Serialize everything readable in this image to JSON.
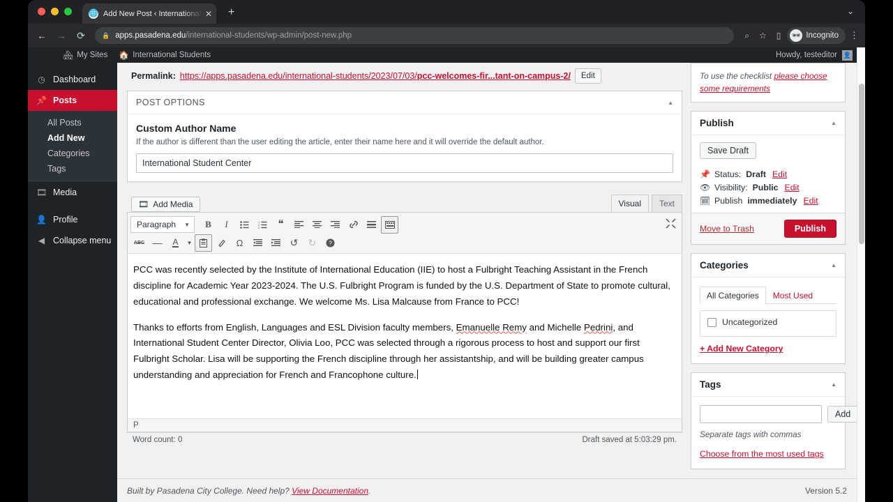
{
  "browser": {
    "tab": {
      "title": "Add New Post ‹ International S",
      "favicon": "globe-icon",
      "close": "✕"
    },
    "newtab_label": "+",
    "window_chevron": "⌄",
    "nav": {
      "back": "←",
      "forward": "→",
      "reload": "⟳"
    },
    "address": {
      "lock": "🔒",
      "domain": "apps.pasadena.edu",
      "path": "/international-students/wp-admin/post-new.php"
    },
    "actions": {
      "search": "⌕",
      "bookmark": "☆",
      "sidepanel": "▯",
      "kebab": "⋮"
    },
    "profile": {
      "label": "Incognito",
      "icon": "incognito-icon"
    }
  },
  "adminbar": {
    "my_sites": "My Sites",
    "site_name": "International Students",
    "howdy": "Howdy, testeditor"
  },
  "sidebar": {
    "items": [
      {
        "label": "Dashboard",
        "icon": "dashboard-icon"
      },
      {
        "label": "Posts",
        "icon": "pin-icon"
      },
      {
        "label": "Media",
        "icon": "media-icon"
      },
      {
        "label": "Profile",
        "icon": "user-icon"
      },
      {
        "label": "Collapse menu",
        "icon": "collapse-icon"
      }
    ],
    "posts_submenu": [
      {
        "label": "All Posts"
      },
      {
        "label": "Add New"
      },
      {
        "label": "Categories"
      },
      {
        "label": "Tags"
      }
    ]
  },
  "permalink": {
    "label": "Permalink:",
    "base": "https://apps.pasadena.edu/international-students/2023/07/03/",
    "slug": "pcc-welcomes-fir...tant-on-campus-2/",
    "edit_button": "Edit"
  },
  "post_options": {
    "panel_title": "POST OPTIONS",
    "field_title": "Custom Author Name",
    "field_description": "If the author is different than the user editing the article, enter their name here and it will override the default author.",
    "field_value": "International Student Center",
    "field_placeholder": ""
  },
  "editor": {
    "add_media": "Add Media",
    "tab_visual": "Visual",
    "tab_text": "Text",
    "format_select": "Paragraph",
    "toolbar_row1": [
      {
        "name": "bold-icon",
        "glyph": "B"
      },
      {
        "name": "italic-icon",
        "glyph": "I"
      },
      {
        "name": "bulleted-list-icon",
        "glyph": "☰"
      },
      {
        "name": "numbered-list-icon",
        "glyph": "☰"
      },
      {
        "name": "blockquote-icon",
        "glyph": "❝"
      },
      {
        "name": "align-left-icon",
        "glyph": "≡"
      },
      {
        "name": "align-center-icon",
        "glyph": "≡"
      },
      {
        "name": "align-right-icon",
        "glyph": "≡"
      },
      {
        "name": "insert-link-icon",
        "glyph": "🔗"
      },
      {
        "name": "read-more-icon",
        "glyph": "▤"
      },
      {
        "name": "toolbar-toggle-icon",
        "glyph": "▦"
      }
    ],
    "toolbar_row2": [
      {
        "name": "strikethrough-icon",
        "glyph": "ABC"
      },
      {
        "name": "horizontal-rule-icon",
        "glyph": "—"
      },
      {
        "name": "text-color-icon",
        "glyph": "A"
      },
      {
        "name": "text-color-caret-icon",
        "glyph": "▾"
      },
      {
        "name": "paste-as-text-icon",
        "glyph": "📋"
      },
      {
        "name": "clear-formatting-icon",
        "glyph": "⌫"
      },
      {
        "name": "special-character-icon",
        "glyph": "Ω"
      },
      {
        "name": "decrease-indent-icon",
        "glyph": "⇤"
      },
      {
        "name": "increase-indent-icon",
        "glyph": "⇥"
      },
      {
        "name": "undo-icon",
        "glyph": "↺"
      },
      {
        "name": "redo-icon",
        "glyph": "↻"
      },
      {
        "name": "keyboard-shortcuts-icon",
        "glyph": "?"
      }
    ],
    "fullscreen_icon": "⤢",
    "body_paragraph_1": "PCC was recently selected by the Institute of International Education (IIE) to host a Fulbright Teaching Assistant in the French discipline for Academic Year 2023-2024. The U.S. Fulbright Program is funded by the U.S. Department of State to promote cultural, educational and professional exchange. We welcome Ms. Lisa Malcause from France to PCC!",
    "body_paragraph_2_a": "Thanks to efforts from English, Languages and ESL Division faculty members, ",
    "body_paragraph_2_mis1": "Emanuelle Remy",
    "body_paragraph_2_b": " and Michelle ",
    "body_paragraph_2_mis2": "Pedrini",
    "body_paragraph_2_c": ", and International Student Center Director, Olivia Loo, PCC was selected through a rigorous process to host and support our first Fulbright Scholar. Lisa will be supporting the French discipline through her assistantship, and will be building greater campus understanding and appreciation for French and Francophone culture.",
    "path_element": "P",
    "word_count": "Word count: 0",
    "draft_saved": "Draft saved at 5:03:29 pm."
  },
  "checklist_notice": {
    "prefix": "To use the checklist ",
    "link": "please choose some requirements"
  },
  "publish": {
    "title": "Publish",
    "save_draft": "Save Draft",
    "status_label": "Status:",
    "status_value": "Draft",
    "status_edit": "Edit",
    "visibility_label": "Visibility:",
    "visibility_value": "Public",
    "visibility_edit": "Edit",
    "schedule_label": "Publish",
    "schedule_value": "immediately",
    "schedule_edit": "Edit",
    "move_to_trash": "Move to Trash",
    "publish_button": "Publish",
    "icons": {
      "status": "pin-icon",
      "visibility": "eye-icon",
      "schedule": "calendar-icon"
    }
  },
  "categories": {
    "title": "Categories",
    "tab_all": "All Categories",
    "tab_most_used": "Most Used",
    "items": [
      {
        "label": "Uncategorized",
        "checked": false
      }
    ],
    "add_new": "+ Add New Category"
  },
  "tags": {
    "title": "Tags",
    "input_value": "",
    "add_button": "Add",
    "hint": "Separate tags with commas",
    "most_used_link": "Choose from the most used tags"
  },
  "footer": {
    "text_before_link": "Built by Pasadena City College. Need help? ",
    "link": "View Documentation",
    "text_after_link": ".",
    "version": "Version 5.2"
  },
  "colors": {
    "brand_red": "#c8102e",
    "admin_dark": "#1d2327",
    "submenu_dark": "#2c3338",
    "page_bg": "#f1f1f1"
  }
}
